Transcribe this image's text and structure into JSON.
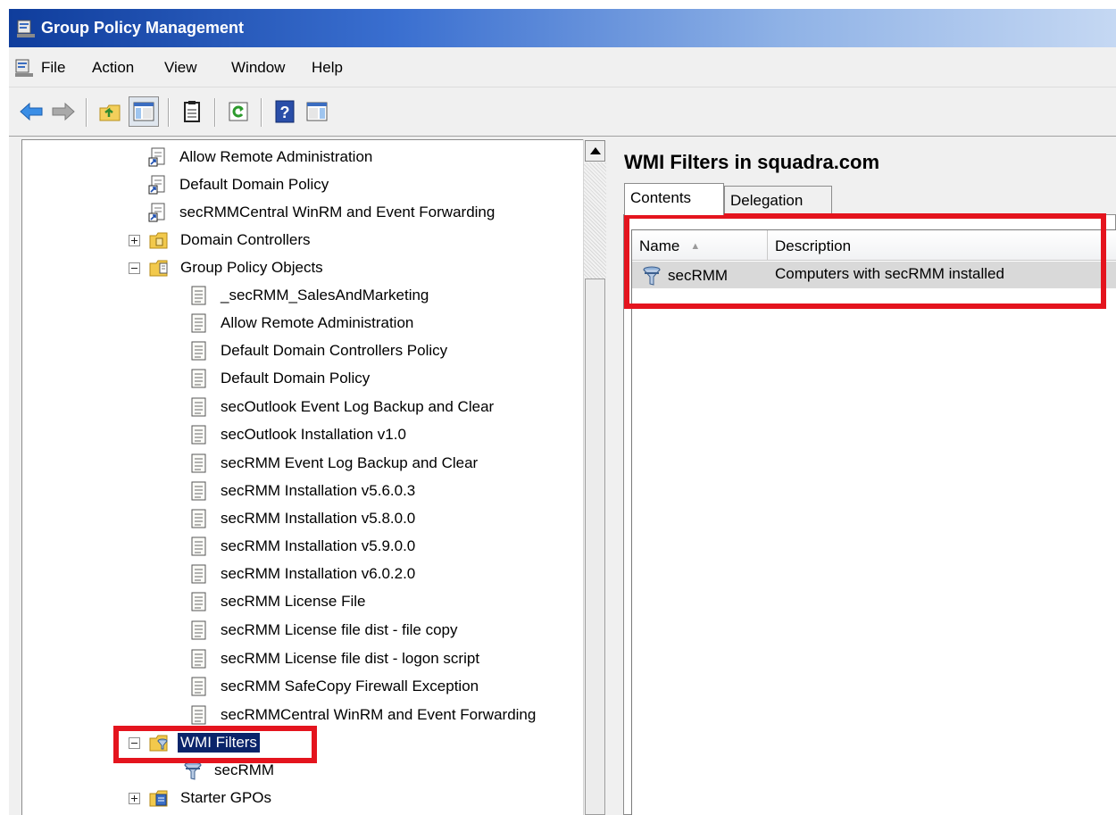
{
  "window": {
    "title": "Group Policy Management"
  },
  "menu": {
    "items": [
      "File",
      "Action",
      "View",
      "Window",
      "Help"
    ]
  },
  "toolbar": {
    "buttons": [
      "back-icon",
      "forward-icon",
      "up-folder-icon",
      "show-hide-tree-icon",
      "properties-icon",
      "refresh-icon",
      "help-icon",
      "show-hide-action-pane-icon"
    ]
  },
  "tree": {
    "rows": [
      {
        "label": "Allow Remote Administration",
        "icon": "gpo-link-icon"
      },
      {
        "label": "Default Domain Policy",
        "icon": "gpo-link-icon"
      },
      {
        "label": "secRMMCentral WinRM and Event Forwarding",
        "icon": "gpo-link-icon"
      },
      {
        "label": "Domain Controllers",
        "icon": "ou-folder-icon",
        "expander": "+"
      },
      {
        "label": "Group Policy Objects",
        "icon": "gpo-folder-icon",
        "expander": "-"
      },
      {
        "label": "_secRMM_SalesAndMarketing",
        "icon": "gpo-icon"
      },
      {
        "label": "Allow Remote Administration",
        "icon": "gpo-icon"
      },
      {
        "label": "Default Domain Controllers Policy",
        "icon": "gpo-icon"
      },
      {
        "label": "Default Domain Policy",
        "icon": "gpo-icon"
      },
      {
        "label": "secOutlook Event Log Backup and Clear",
        "icon": "gpo-icon"
      },
      {
        "label": "secOutlook Installation v1.0",
        "icon": "gpo-icon"
      },
      {
        "label": "secRMM Event Log Backup and Clear",
        "icon": "gpo-icon"
      },
      {
        "label": "secRMM Installation v5.6.0.3",
        "icon": "gpo-icon"
      },
      {
        "label": "secRMM Installation v5.8.0.0",
        "icon": "gpo-icon"
      },
      {
        "label": "secRMM Installation v5.9.0.0",
        "icon": "gpo-icon"
      },
      {
        "label": "secRMM Installation v6.0.2.0",
        "icon": "gpo-icon"
      },
      {
        "label": "secRMM License File",
        "icon": "gpo-icon"
      },
      {
        "label": "secRMM License file dist - file copy",
        "icon": "gpo-icon"
      },
      {
        "label": "secRMM License file dist - logon script",
        "icon": "gpo-icon"
      },
      {
        "label": "secRMM SafeCopy Firewall Exception",
        "icon": "gpo-icon"
      },
      {
        "label": "secRMMCentral WinRM and Event Forwarding",
        "icon": "gpo-icon"
      },
      {
        "label": "WMI Filters",
        "icon": "wmi-folder-icon",
        "expander": "-",
        "selected": true
      },
      {
        "label": "secRMM",
        "icon": "wmi-filter-icon"
      },
      {
        "label": "Starter GPOs",
        "icon": "starter-gpo-folder-icon",
        "expander": "+"
      }
    ]
  },
  "details": {
    "title": "WMI Filters in squadra.com",
    "tabs": [
      "Contents",
      "Delegation"
    ],
    "active_tab": "Contents",
    "columns": [
      "Name",
      "Description"
    ],
    "sorted_column": "Name",
    "rows": [
      {
        "name": "secRMM",
        "description": "Computers with secRMM installed",
        "icon": "wmi-filter-icon"
      }
    ]
  },
  "colors": {
    "highlight_box": "#e4141e",
    "selection": "#0a246a"
  }
}
